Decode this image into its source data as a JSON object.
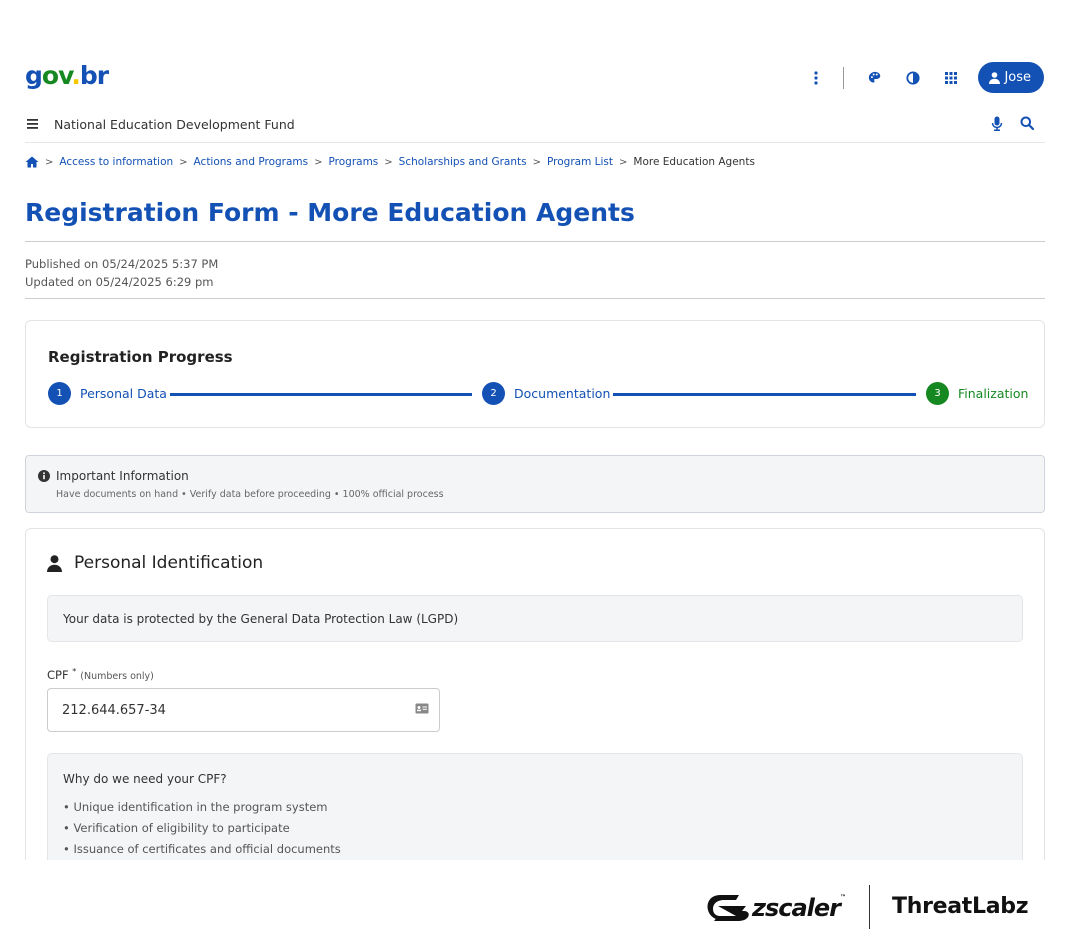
{
  "header": {
    "logo": {
      "g": "g",
      "ov": "ov",
      "dot": ".",
      "br": "br"
    },
    "user_label": "Jose",
    "icons": [
      "more-vertical-icon",
      "palette-icon",
      "contrast-icon",
      "apps-grid-icon",
      "user-icon"
    ]
  },
  "nav": {
    "title": "National Education Development Fund",
    "icons": [
      "menu-icon",
      "microphone-icon",
      "search-icon"
    ]
  },
  "breadcrumb": {
    "separator": ">",
    "items": [
      "Access to information",
      "Actions and Programs",
      "Programs",
      "Scholarships and Grants",
      "Program List"
    ],
    "current": "More Education Agents"
  },
  "page": {
    "title": "Registration Form - More Education Agents",
    "published": "Published on 05/24/2025 5:37 PM",
    "updated": "Updated on 05/24/2025 6:29 pm"
  },
  "progress": {
    "title": "Registration Progress",
    "steps": [
      {
        "num": "1",
        "label": "Personal Data"
      },
      {
        "num": "2",
        "label": "Documentation"
      },
      {
        "num": "3",
        "label": "Finalization"
      }
    ]
  },
  "info": {
    "title": "Important Information",
    "description": "Have documents on hand • Verify data before proceeding • 100% official process"
  },
  "personal": {
    "title": "Personal Identification",
    "lgpd": "Your data is protected by the General Data Protection Law (LGPD)",
    "cpf_label": "CPF",
    "cpf_required": "*",
    "cpf_hint": "(Numbers only)",
    "cpf_value": "212.644.657-34",
    "why_title": "Why do we need your CPF?",
    "why_items": [
      "• Unique identification in the program system",
      "• Verification of eligibility to participate",
      "• Issuance of certificates and official documents"
    ]
  },
  "footer": {
    "zscaler": "zscaler",
    "tm": "™",
    "threatlabz": "ThreatLabz"
  },
  "colors": {
    "primary": "#1351b4",
    "success": "#168821",
    "logo_yellow": "#f7c700"
  }
}
